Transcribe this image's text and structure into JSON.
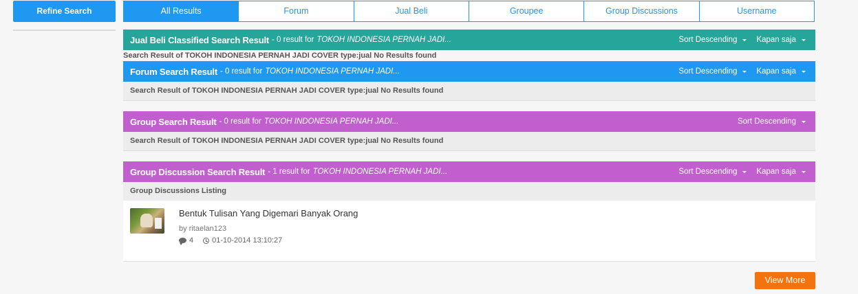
{
  "sidebar": {
    "refine_label": "Refine Search"
  },
  "tabs": [
    {
      "label": "All Results"
    },
    {
      "label": "Forum"
    },
    {
      "label": "Jual Beli"
    },
    {
      "label": "Groupee"
    },
    {
      "label": "Group Discussions"
    },
    {
      "label": "Username"
    }
  ],
  "sections": {
    "jualbeli": {
      "title": "Jual Beli Classified Search Result",
      "count": "- 0 result for",
      "query": "TOKOH INDONESIA PERNAH JADI...",
      "sort": "Sort Descending",
      "time": "Kapan saja",
      "info": "Search Result of TOKOH INDONESIA PERNAH JADI COVER type:jual No Results found"
    },
    "forum": {
      "title": "Forum Search Result",
      "count": "- 0 result for",
      "query": "TOKOH INDONESIA PERNAH JADI...",
      "sort": "Sort Descending",
      "time": "Kapan saja",
      "info": "Search Result of TOKOH INDONESIA PERNAH JADI COVER type:jual No Results found"
    },
    "group": {
      "title": "Group Search Result",
      "count": "- 0 result for",
      "query": "TOKOH INDONESIA PERNAH JADI...",
      "sort": "Sort Descending",
      "info": "Search Result of TOKOH INDONESIA PERNAH JADI COVER type:jual No Results found"
    },
    "discussion": {
      "title": "Group Discussion Search Result",
      "count": "- 1 result for",
      "query": "TOKOH INDONESIA PERNAH JADI...",
      "sort": "Sort Descending",
      "time": "Kapan saja",
      "info": "Group Discussions Listing",
      "result": {
        "title": "Bentuk Tulisan Yang Digemari Banyak Orang",
        "by": "by ritaelan123",
        "comments": "4",
        "date": "01-10-2014 13:10:27"
      }
    }
  },
  "view_more": "View More",
  "colors": {
    "teal": "#26a69a",
    "blue": "#1e98f0",
    "purple": "#c05fcd",
    "orange": "#f5730f"
  }
}
